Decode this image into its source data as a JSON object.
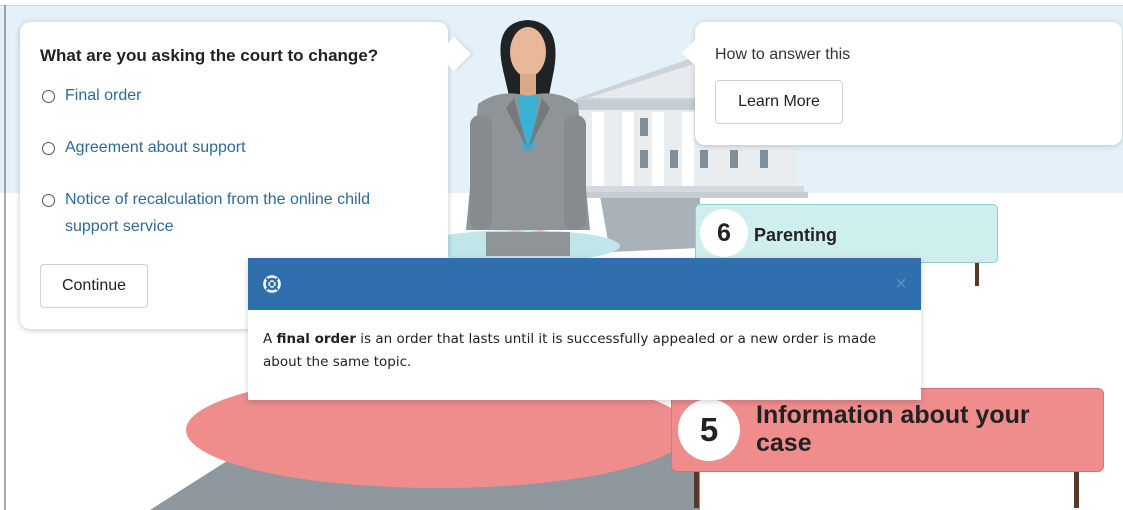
{
  "question": {
    "title": "What are you asking the court to change?",
    "options": [
      "Final order",
      "Agreement about support",
      "Notice of recalculation from the online child support service"
    ],
    "continue_label": "Continue"
  },
  "help": {
    "title": "How to answer this",
    "learn_more_label": "Learn More"
  },
  "steps": [
    {
      "number": "6",
      "label": "Parenting"
    },
    {
      "number": "5",
      "label": "Information about your case"
    }
  ],
  "modal": {
    "icon": "lifebuoy-icon",
    "close_symbol": "×",
    "text_before": "A ",
    "term": "final order",
    "text_after": " is an order that lasts until it is successfully appealed or a new order is made about the same topic."
  },
  "colors": {
    "modal_header": "#2f6fae",
    "step6_fill": "#cfeeee",
    "step5_fill": "#ef8d8d",
    "link_text": "#2d6a9a",
    "sky": "#e4f1f8"
  }
}
